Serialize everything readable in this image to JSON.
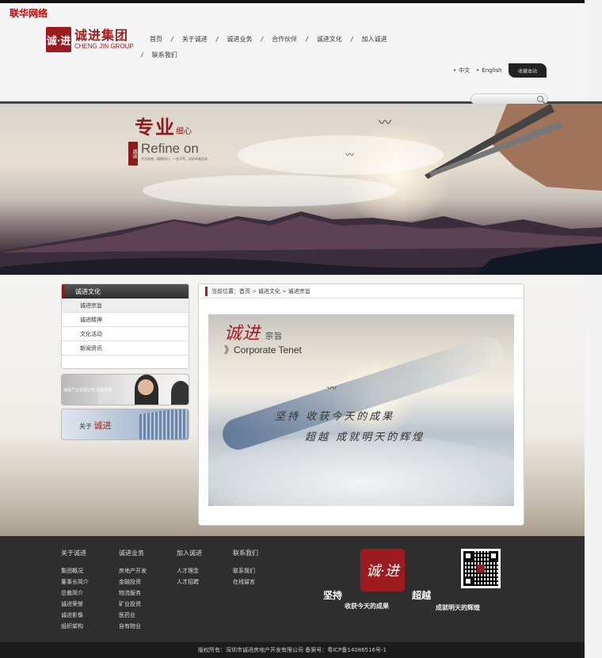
{
  "watermark": "联华网络",
  "logo": {
    "mark": "诚·进",
    "cn": "诚进集团",
    "en": "CHENG JIN GROUP"
  },
  "nav": {
    "row1": [
      "首页",
      "关于诚进",
      "诚进业务",
      "合作伙伴",
      "诚进文化",
      "加入诚进"
    ],
    "row2": [
      "联系我们"
    ],
    "separator": "/"
  },
  "lang": {
    "zh": "中文",
    "en": "English"
  },
  "favorite_label": "收藏本站",
  "search": {
    "placeholder": ""
  },
  "banner": {
    "title_cn": "专业",
    "title_small": "细心",
    "seal": "诚进",
    "title_en": "Refine on",
    "subtitle": "专业态度，精细执行，一丝不苟，追求卓越品质。"
  },
  "sidebar": {
    "heading": "诚进文化",
    "items": [
      "诚进宗旨",
      "诚进精神",
      "文化活动",
      "新闻资讯"
    ],
    "promo1_text": "诚进产业有限公司 团队招聘",
    "promo2_prefix": "关于",
    "promo2_brand": "诚进"
  },
  "breadcrumb": {
    "label": "当前位置：",
    "home": "首页",
    "section": "诚进文化",
    "current": "诚进宗旨",
    "sep1": ">",
    "sep2": ">"
  },
  "article": {
    "title_cn": "诚进",
    "title_small": "宗旨",
    "title_en": "》Corporate Tenet",
    "line1": "坚持 收获今天的成果",
    "line2": "超越 成就明天的辉煌"
  },
  "footer": {
    "columns": [
      {
        "title": "关于诚进",
        "items": [
          "集团概况",
          "董事长简介",
          "总裁简介",
          "诚进荣誉",
          "诚进影像",
          "组织架构"
        ]
      },
      {
        "title": "诚进业务",
        "items": [
          "房地产开发",
          "金融投资",
          "物流服务",
          "矿业投资",
          "医药业",
          "自有物业"
        ]
      },
      {
        "title": "加入诚进",
        "items": [
          "人才理念",
          "人才招聘"
        ]
      },
      {
        "title": "联系我们",
        "items": [
          "联系我们",
          "在线留言"
        ]
      }
    ],
    "seal": "诚·进",
    "slogan_a": "坚持",
    "slogan_b": "超越",
    "slogan_c": "收获今天的成果",
    "slogan_d": "成就明天的辉煌",
    "copyright": "版权所有：深圳市诚进房地产开发有限公司  备案号：粤ICP备14086516号-1"
  },
  "colors": {
    "brand_red": "#9b1b1e",
    "footer_bg": "#2e2e2e"
  }
}
